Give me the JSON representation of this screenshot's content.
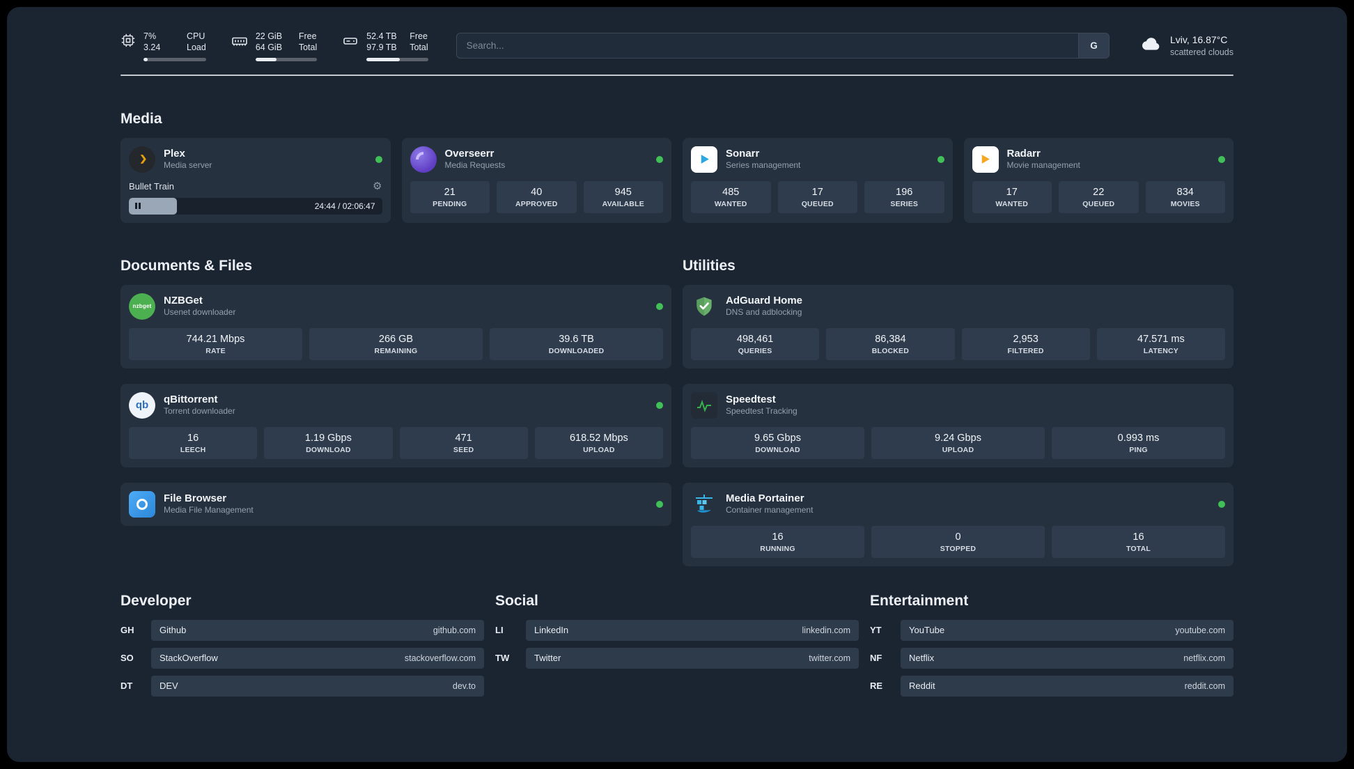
{
  "colors": {
    "background": "#1B2431",
    "card": "#26313F",
    "tile": "#2F3C4D",
    "status_online": "#40C057",
    "plex_gold": "#E5A00D",
    "sonarr_blue": "#2DA7E0",
    "radarr_orange": "#F5A623",
    "adguard_green": "#68B06B",
    "qbittorrent_blue": "#2D6FB8",
    "nzbget_green": "#4CAF50",
    "portainer_blue": "#38B6E8"
  },
  "header": {
    "cpu": {
      "value_top": "7%",
      "value_bottom": "3.24",
      "label_top": "CPU",
      "label_bottom": "Load",
      "bar_percent": 7
    },
    "ram": {
      "value_top": "22 GiB",
      "value_bottom": "64 GiB",
      "label_top": "Free",
      "label_bottom": "Total",
      "bar_percent": 34
    },
    "disk": {
      "value_top": "52.4 TB",
      "value_bottom": "97.9 TB",
      "label_top": "Free",
      "label_bottom": "Total",
      "bar_percent": 54
    },
    "search": {
      "placeholder": "Search...",
      "engine": "G"
    },
    "weather": {
      "location": "Lviv, 16.87°C",
      "condition": "scattered clouds"
    }
  },
  "media": {
    "title": "Media",
    "plex": {
      "name": "Plex",
      "subtitle": "Media server",
      "now_playing": "Bullet Train",
      "time": "24:44 / 02:06:47",
      "progress_percent": 19
    },
    "overseerr": {
      "name": "Overseerr",
      "subtitle": "Media Requests",
      "stats": [
        {
          "value": "21",
          "label": "PENDING"
        },
        {
          "value": "40",
          "label": "APPROVED"
        },
        {
          "value": "945",
          "label": "AVAILABLE"
        }
      ]
    },
    "sonarr": {
      "name": "Sonarr",
      "subtitle": "Series management",
      "stats": [
        {
          "value": "485",
          "label": "WANTED"
        },
        {
          "value": "17",
          "label": "QUEUED"
        },
        {
          "value": "196",
          "label": "SERIES"
        }
      ]
    },
    "radarr": {
      "name": "Radarr",
      "subtitle": "Movie management",
      "stats": [
        {
          "value": "17",
          "label": "WANTED"
        },
        {
          "value": "22",
          "label": "QUEUED"
        },
        {
          "value": "834",
          "label": "MOVIES"
        }
      ]
    }
  },
  "documents": {
    "title": "Documents & Files",
    "nzbget": {
      "name": "NZBGet",
      "subtitle": "Usenet downloader",
      "icon_text": "nzbget",
      "stats": [
        {
          "value": "744.21 Mbps",
          "label": "RATE"
        },
        {
          "value": "266 GB",
          "label": "REMAINING"
        },
        {
          "value": "39.6 TB",
          "label": "DOWNLOADED"
        }
      ]
    },
    "qbittorrent": {
      "name": "qBittorrent",
      "subtitle": "Torrent downloader",
      "icon_text": "qb",
      "stats": [
        {
          "value": "16",
          "label": "LEECH"
        },
        {
          "value": "1.19 Gbps",
          "label": "DOWNLOAD"
        },
        {
          "value": "471",
          "label": "SEED"
        },
        {
          "value": "618.52 Mbps",
          "label": "UPLOAD"
        }
      ]
    },
    "filebrowser": {
      "name": "File Browser",
      "subtitle": "Media File Management"
    }
  },
  "utilities": {
    "title": "Utilities",
    "adguard": {
      "name": "AdGuard Home",
      "subtitle": "DNS and adblocking",
      "stats": [
        {
          "value": "498,461",
          "label": "QUERIES"
        },
        {
          "value": "86,384",
          "label": "BLOCKED"
        },
        {
          "value": "2,953",
          "label": "FILTERED"
        },
        {
          "value": "47.571 ms",
          "label": "LATENCY"
        }
      ]
    },
    "speedtest": {
      "name": "Speedtest",
      "subtitle": "Speedtest Tracking",
      "stats": [
        {
          "value": "9.65 Gbps",
          "label": "DOWNLOAD"
        },
        {
          "value": "9.24 Gbps",
          "label": "UPLOAD"
        },
        {
          "value": "0.993 ms",
          "label": "PING"
        }
      ]
    },
    "portainer": {
      "name": "Media Portainer",
      "subtitle": "Container management",
      "stats": [
        {
          "value": "16",
          "label": "RUNNING"
        },
        {
          "value": "0",
          "label": "STOPPED"
        },
        {
          "value": "16",
          "label": "TOTAL"
        }
      ]
    }
  },
  "developer": {
    "title": "Developer",
    "links": [
      {
        "code": "GH",
        "name": "Github",
        "url": "github.com"
      },
      {
        "code": "SO",
        "name": "StackOverflow",
        "url": "stackoverflow.com"
      },
      {
        "code": "DT",
        "name": "DEV",
        "url": "dev.to"
      }
    ]
  },
  "social": {
    "title": "Social",
    "links": [
      {
        "code": "LI",
        "name": "LinkedIn",
        "url": "linkedin.com"
      },
      {
        "code": "TW",
        "name": "Twitter",
        "url": "twitter.com"
      }
    ]
  },
  "entertainment": {
    "title": "Entertainment",
    "links": [
      {
        "code": "YT",
        "name": "YouTube",
        "url": "youtube.com"
      },
      {
        "code": "NF",
        "name": "Netflix",
        "url": "netflix.com"
      },
      {
        "code": "RE",
        "name": "Reddit",
        "url": "reddit.com"
      }
    ]
  }
}
